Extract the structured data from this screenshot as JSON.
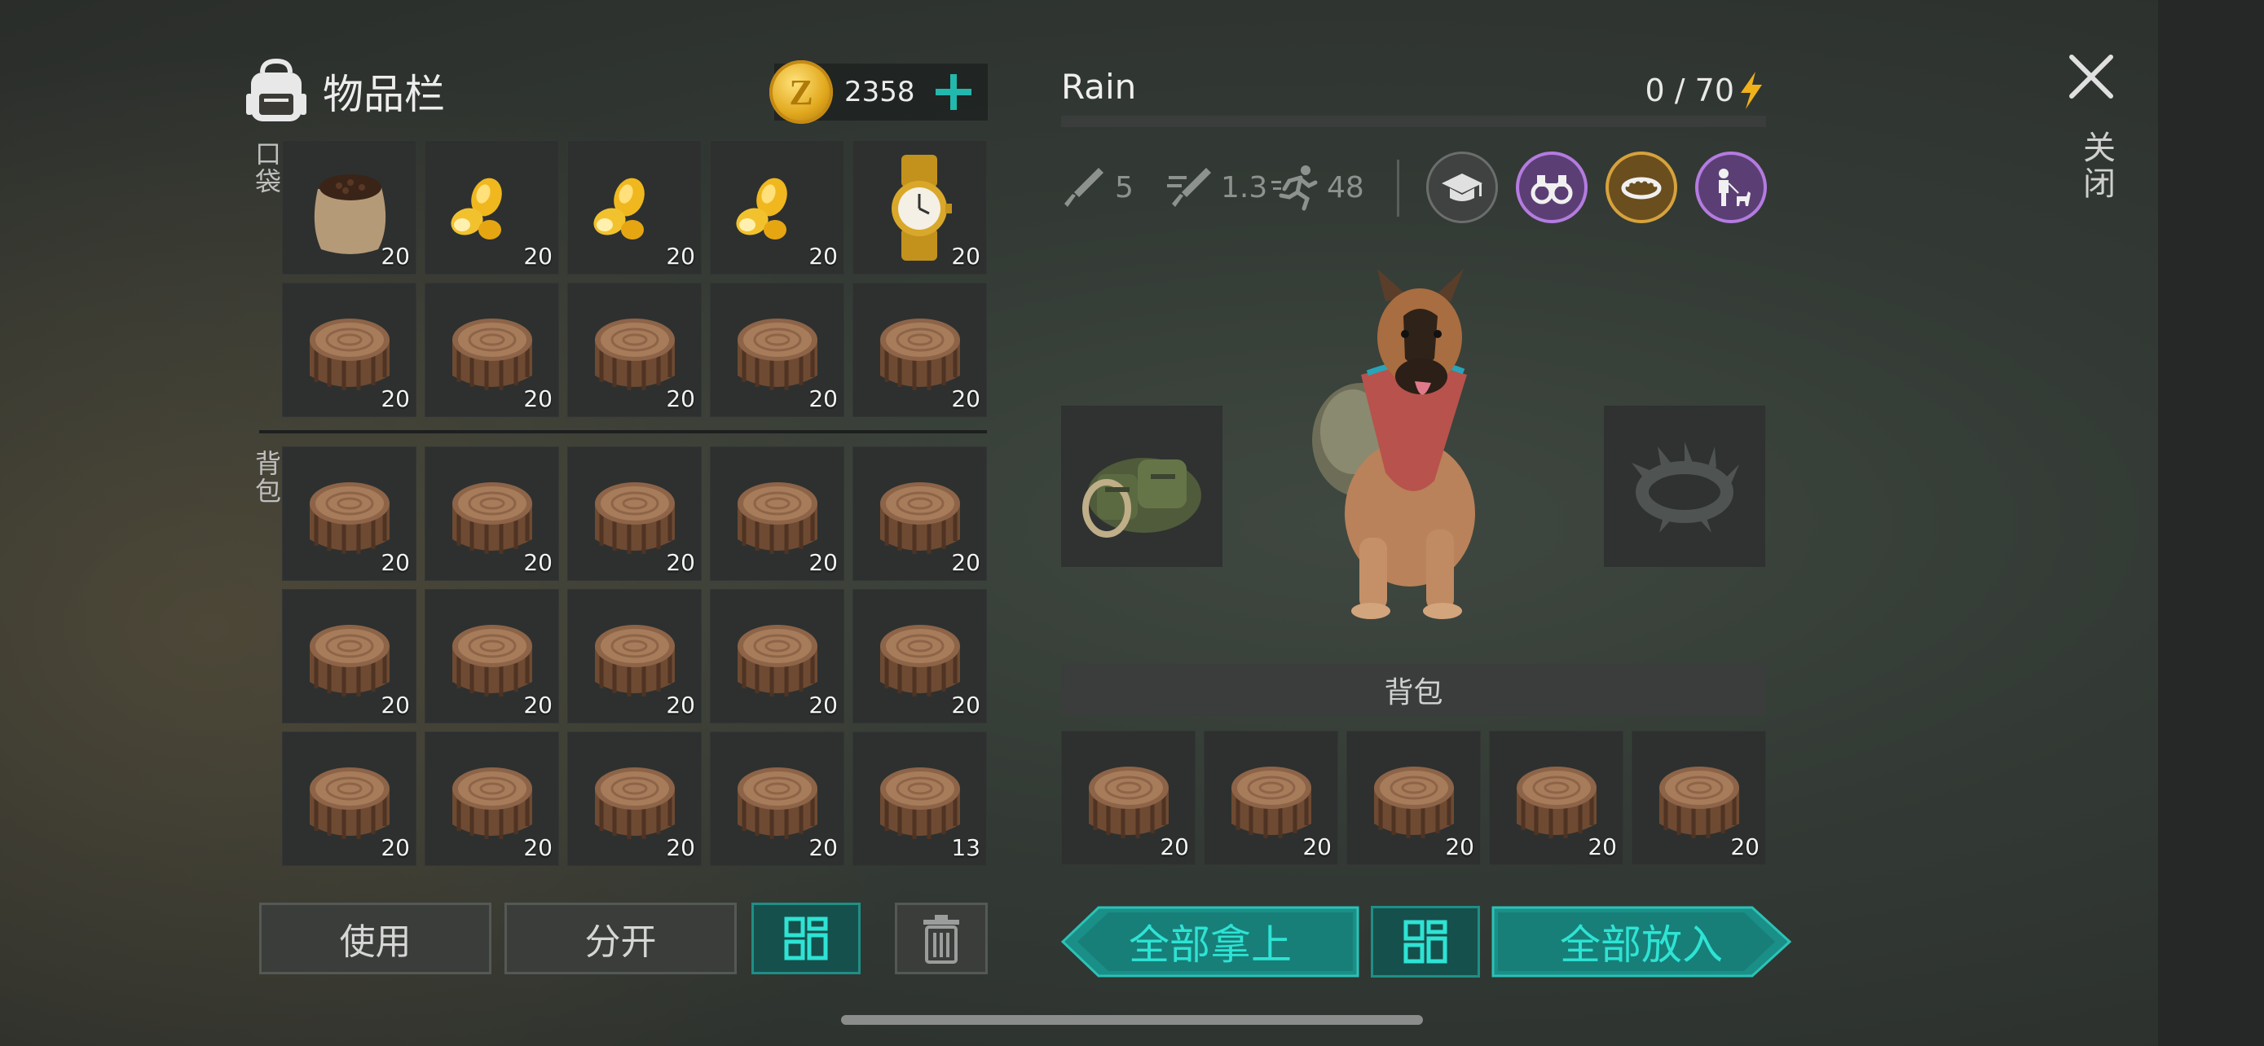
{
  "inventory": {
    "title": "物品栏",
    "coins": "2358",
    "coin_symbol": "Z",
    "pocket_label": "口袋",
    "backpack_label": "背包",
    "pocket_slots": [
      {
        "item": "seed-sack-icon",
        "qty": "20"
      },
      {
        "item": "corn-icon",
        "qty": "20"
      },
      {
        "item": "corn-icon",
        "qty": "20"
      },
      {
        "item": "corn-icon",
        "qty": "20"
      },
      {
        "item": "gold-watch-icon",
        "qty": "20"
      },
      {
        "item": "log-icon",
        "qty": "20"
      },
      {
        "item": "log-icon",
        "qty": "20"
      },
      {
        "item": "log-icon",
        "qty": "20"
      },
      {
        "item": "log-icon",
        "qty": "20"
      },
      {
        "item": "log-icon",
        "qty": "20"
      }
    ],
    "backpack_slots": [
      {
        "item": "log-icon",
        "qty": "20"
      },
      {
        "item": "log-icon",
        "qty": "20"
      },
      {
        "item": "log-icon",
        "qty": "20"
      },
      {
        "item": "log-icon",
        "qty": "20"
      },
      {
        "item": "log-icon",
        "qty": "20"
      },
      {
        "item": "log-icon",
        "qty": "20"
      },
      {
        "item": "log-icon",
        "qty": "20"
      },
      {
        "item": "log-icon",
        "qty": "20"
      },
      {
        "item": "log-icon",
        "qty": "20"
      },
      {
        "item": "log-icon",
        "qty": "20"
      },
      {
        "item": "log-icon",
        "qty": "20"
      },
      {
        "item": "log-icon",
        "qty": "20"
      },
      {
        "item": "log-icon",
        "qty": "20"
      },
      {
        "item": "log-icon",
        "qty": "20"
      },
      {
        "item": "log-icon",
        "qty": "13"
      }
    ],
    "buttons": {
      "use": "使用",
      "split": "分开"
    }
  },
  "pet": {
    "name": "Rain",
    "energy": "0 / 70",
    "energy_fill": 0,
    "stats": {
      "attack": "5",
      "attack_speed": "1.3",
      "speed": "48"
    },
    "perks": [
      {
        "icon": "graduation-cap-icon",
        "color": "#4a4d4b",
        "border": "#6b6e6c"
      },
      {
        "icon": "binoculars-icon",
        "color": "#5b3f74",
        "border": "#b47be0"
      },
      {
        "icon": "spiked-collar-icon",
        "color": "#6b4e1e",
        "border": "#d6a23c"
      },
      {
        "icon": "person-with-dog-icon",
        "color": "#5b3f74",
        "border": "#b47be0"
      }
    ],
    "equipped_left": "dog-backpack-icon",
    "equipped_right": "spiked-collar-placeholder-icon",
    "pack_label": "背包",
    "pack_slots": [
      {
        "item": "log-icon",
        "qty": "20"
      },
      {
        "item": "log-icon",
        "qty": "20"
      },
      {
        "item": "log-icon",
        "qty": "20"
      },
      {
        "item": "log-icon",
        "qty": "20"
      },
      {
        "item": "log-icon",
        "qty": "20"
      }
    ],
    "take_all": "全部拿上",
    "put_all": "全部放入"
  },
  "close_label": "关闭",
  "colors": {
    "teal_accent": "#22b8ad",
    "gold": "#e2a91e",
    "purple": "#b47be0"
  }
}
